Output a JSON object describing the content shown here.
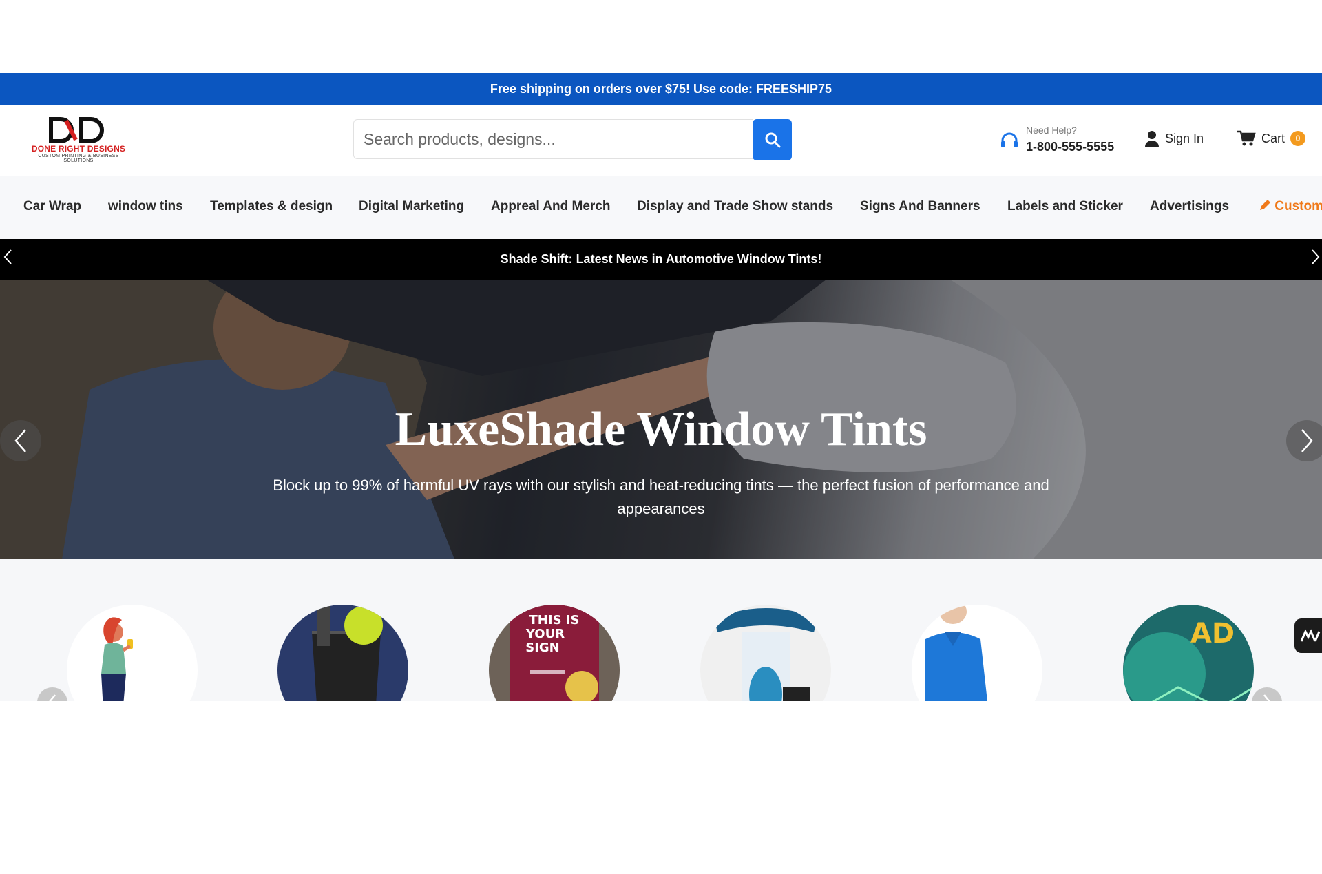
{
  "promo": {
    "text": "Free shipping on orders over $75! Use code: FREESHIP75"
  },
  "header": {
    "logo_mark": "DRD",
    "logo_name": "DONE RIGHT DESIGNS",
    "logo_tagline": "CUSTOM PRINTING & BUSINESS SOLUTIONS",
    "search_placeholder": "Search products, designs...",
    "help_label": "Need Help?",
    "help_phone": "1-800-555-5555",
    "signin_label": "Sign In",
    "cart_label": "Cart",
    "cart_count": "0"
  },
  "nav": {
    "items": [
      "Car Wrap",
      "window tins",
      "Templates & design",
      "Digital Marketing",
      "Appreal And Merch",
      "Display and Trade Show stands",
      "Signs And Banners",
      "Labels and Sticker",
      "Advertisings"
    ],
    "custom_label": "Custom"
  },
  "news": {
    "text": "Shade Shift: Latest News in Automotive Window Tints!"
  },
  "hero": {
    "title": "LuxeShade Window Tints",
    "subtitle": "Block up to 99% of harmful UV rays with our stylish and heat-reducing tints — the perfect fusion of performance and appearances"
  },
  "categories": {
    "circles": [
      {
        "name": "woman-phone"
      },
      {
        "name": "pen-holder"
      },
      {
        "name": "this-is-your-sign",
        "text": "THIS IS YOUR SIGN"
      },
      {
        "name": "trade-show-booth"
      },
      {
        "name": "polo-shirt"
      },
      {
        "name": "advertising",
        "text": "AD"
      }
    ]
  },
  "colors": {
    "brand_blue": "#0b56c0",
    "search_blue": "#1a73e8",
    "accent_orange": "#f07a1a",
    "cart_badge": "#f39a1e",
    "logo_red": "#d41f1f"
  },
  "icons": [
    "search-icon",
    "headset-icon",
    "user-icon",
    "cart-icon",
    "pencil-icon",
    "chevron-left-icon",
    "chevron-right-icon",
    "chat-icon"
  ]
}
